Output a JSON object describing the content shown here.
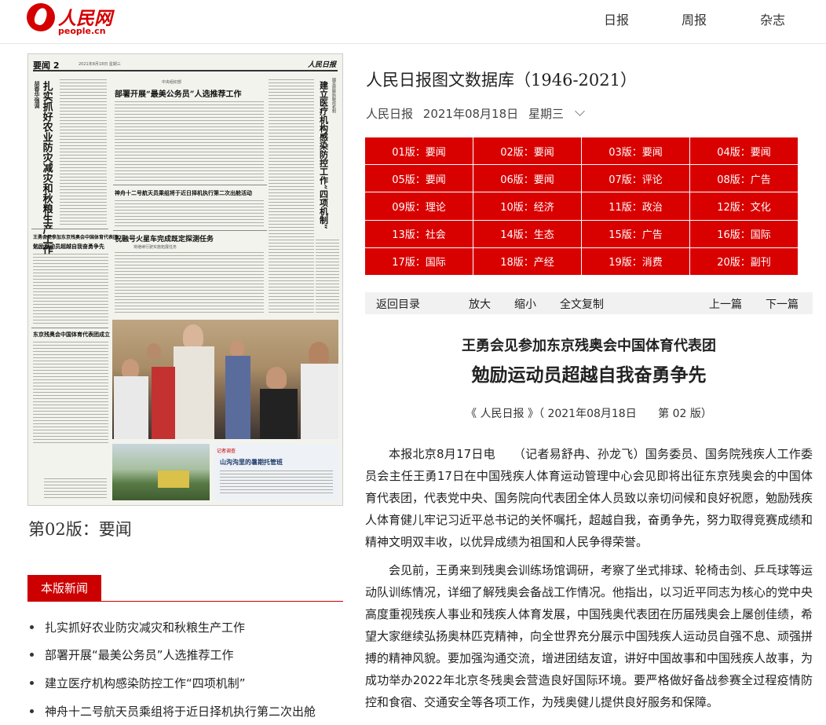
{
  "header": {
    "logo_cn": "人民网",
    "logo_en": "people.cn",
    "nav": [
      "日报",
      "周报",
      "杂志"
    ]
  },
  "paper_thumb": {
    "section": "要闻 2",
    "date_line": "2021年8月18日 星期三",
    "masthead": "人民日报",
    "headline_vertical": "扎实抓好农业防灾减灾和秋粮生产工作",
    "author": "胡春华强调",
    "headline_org": "中央组织部",
    "headline_1": "部署开展“最美公务员”人选推荐工作",
    "headline_2": "神舟十二号航天员乘组将于近日择机执行第二次出舱活动",
    "headline_3": "祝融号火星车完成既定探测任务",
    "headline_3_sub": "将继续行驶实施拓展任务",
    "headline_4_pre": "王勇会见参加东京残奥会中国体育代表团",
    "headline_4": "勉励运动员超越自我奋勇争先",
    "headline_5": "东京残奥会中国体育代表团成立",
    "right_vertical": "建立医疗机构感染防控工作“四项机制”",
    "right_vertical_pre": "国务院联防联控机制",
    "box_tag": "记者调查",
    "box_title": "山沟沟里的暑期托管班"
  },
  "page_title": "第02版：要闻",
  "section_tab": "本版新闻",
  "news_items": [
    "扎实抓好农业防灾减灾和秋粮生产工作",
    "部署开展“最美公务员”人选推荐工作",
    "建立医疗机构感染防控工作“四项机制”",
    "神舟十二号航天员乘组将于近日择机执行第二次出舱"
  ],
  "db_title": "人民日报图文数据库（1946-2021）",
  "date_row": {
    "paper": "人民日报",
    "date": "2021年08月18日",
    "weekday": "星期三"
  },
  "editions": [
    "01版：要闻",
    "02版：要闻",
    "03版：要闻",
    "04版：要闻",
    "05版：要闻",
    "06版：要闻",
    "07版：评论",
    "08版：广告",
    "09版：理论",
    "10版：经济",
    "11版：政治",
    "12版：文化",
    "13版：社会",
    "14版：生态",
    "15版：广告",
    "16版：国际",
    "17版：国际",
    "18版：产经",
    "19版：消费",
    "20版：副刊"
  ],
  "toolbar": {
    "back": "返回目录",
    "zoom_in": "放大",
    "zoom_out": "缩小",
    "copy": "全文复制",
    "prev": "上一篇",
    "next": "下一篇"
  },
  "article": {
    "subtitle": "王勇会见参加东京残奥会中国体育代表团",
    "title": "勉励运动员超越自我奋勇争先",
    "meta_source": "《 人民日报 》（ 2021年08月18日",
    "meta_page": "第 02 版）",
    "paragraphs": [
      "本报北京8月17日电　　（记者易舒冉、孙龙飞）国务委员、国务院残疾人工作委员会主任王勇17日在中国残疾人体育运动管理中心会见即将出征东京残奥会的中国体育代表团，代表党中央、国务院向代表团全体人员致以亲切问候和良好祝愿，勉励残疾人体育健儿牢记习近平总书记的关怀嘱托，超越自我，奋勇争先，努力取得竞赛成绩和精神文明双丰收，以优异成绩为祖国和人民争得荣誉。",
      "会见前，王勇来到残奥会训练场馆调研，考察了坐式排球、轮椅击剑、乒乓球等运动队训练情况，详细了解残奥会备战工作情况。他指出，以习近平同志为核心的党中央高度重视残疾人事业和残疾人体育发展，中国残奥代表团在历届残奥会上屡创佳绩，希望大家继续弘扬奥林匹克精神，向全世界充分展示中国残疾人运动员自强不息、顽强拼搏的精神风貌。要加强沟通交流，增进团结友谊，讲好中国故事和中国残疾人故事，为成功举办2022年北京冬残奥会营造良好国际环境。要严格做好备战参赛全过程疫情防控和食宿、交通安全等各项工作，为残奥健儿提供良好服务和保障。"
    ]
  },
  "colors": {
    "brand_red": "#d90000",
    "dark_red": "#cc0000"
  }
}
